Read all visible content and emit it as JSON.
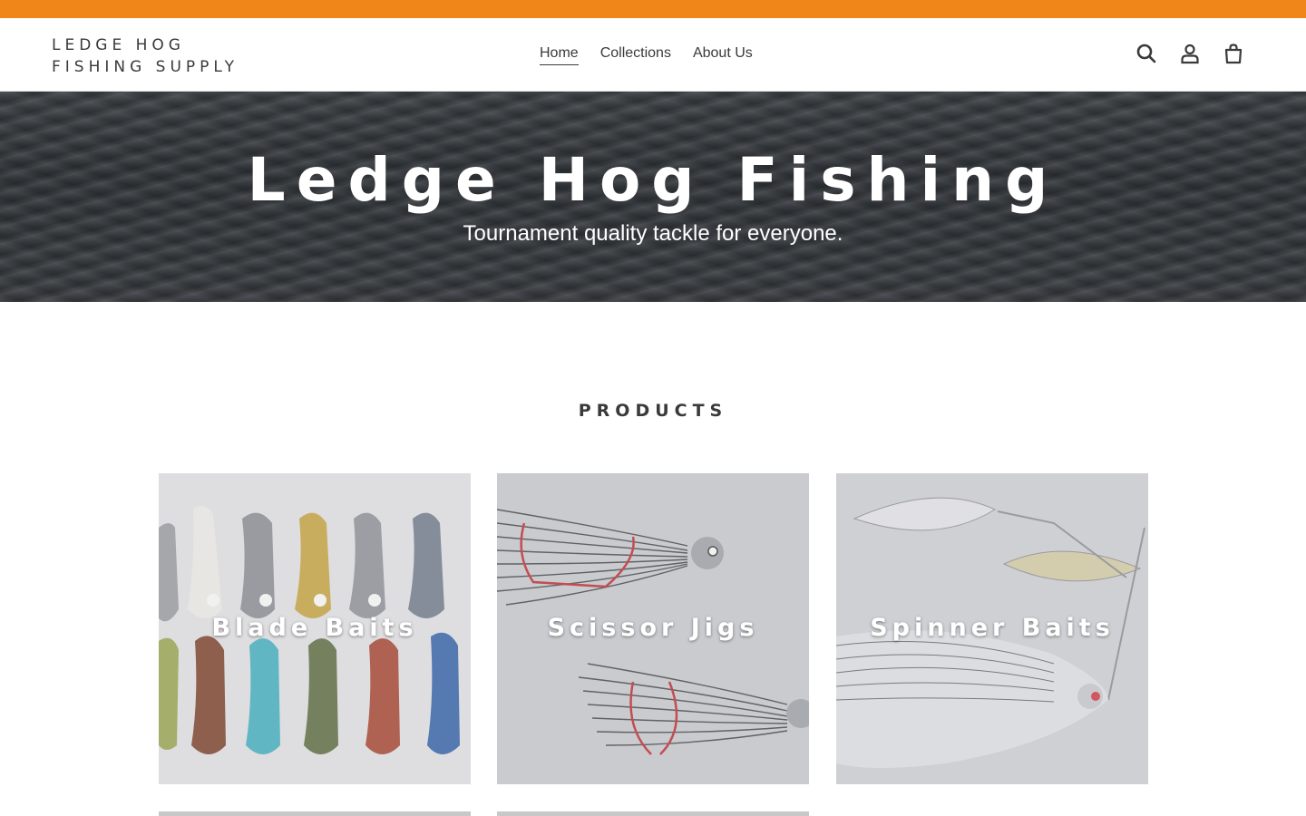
{
  "colors": {
    "announcement": "#f08519",
    "text": "#3a3a3a",
    "white": "#ffffff"
  },
  "header": {
    "logo_line1": "LEDGE HOG",
    "logo_line2": "FISHING SUPPLY",
    "nav": [
      {
        "label": "Home",
        "active": true
      },
      {
        "label": "Collections",
        "active": false
      },
      {
        "label": "About Us",
        "active": false
      }
    ],
    "icons": [
      "search-icon",
      "account-icon",
      "cart-icon"
    ]
  },
  "hero": {
    "title": "Ledge Hog Fishing",
    "subtitle": "Tournament quality tackle for everyone."
  },
  "products": {
    "heading": "PRODUCTS",
    "collections": [
      {
        "title": "Blade Baits"
      },
      {
        "title": "Scissor Jigs"
      },
      {
        "title": "Spinner Baits"
      },
      {
        "title": ""
      },
      {
        "title": ""
      }
    ]
  }
}
